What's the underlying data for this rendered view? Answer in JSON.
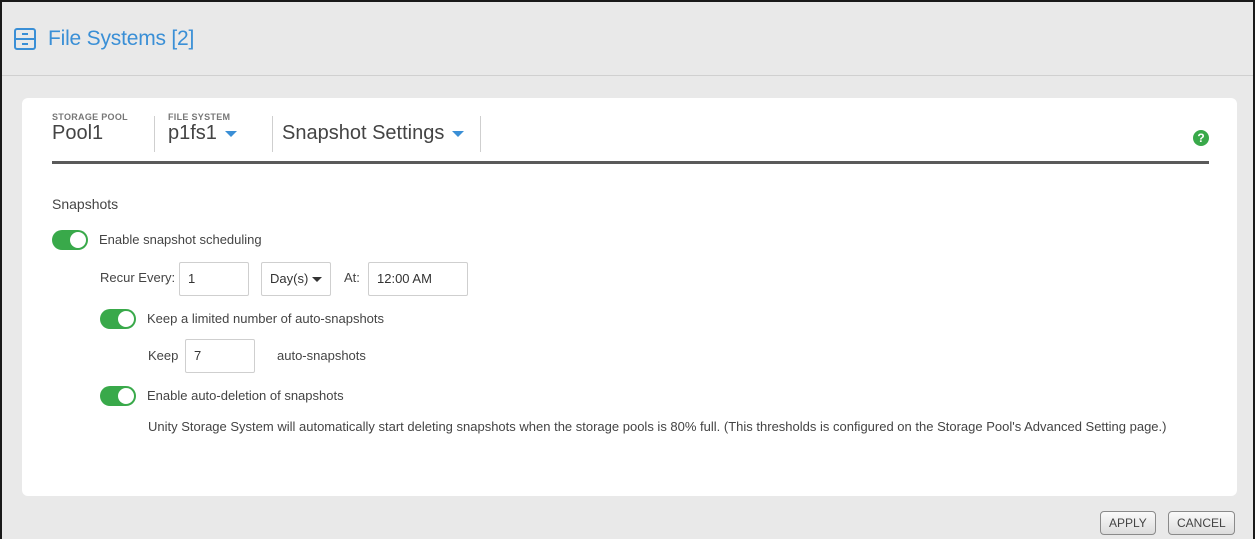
{
  "header": {
    "title": "File Systems [2]",
    "icon": "file-system-icon",
    "accent": "#3a8fd6"
  },
  "breadcrumb": {
    "storage_pool_label": "STORAGE POOL",
    "storage_pool_value": "Pool1",
    "file_system_label": "FILE SYSTEM",
    "file_system_value": "p1fs1",
    "settings_value": "Snapshot Settings",
    "help_icon": "?"
  },
  "snapshots": {
    "section_title": "Snapshots",
    "enable_scheduling": {
      "label": "Enable snapshot scheduling",
      "on": true
    },
    "recur_every_label": "Recur Every:",
    "recur_every_value": "1",
    "unit_value": "Day(s)",
    "at_label": "At:",
    "at_value": "12:00 AM",
    "keep_limited": {
      "label": "Keep a limited number of auto-snapshots",
      "on": true
    },
    "keep_label": "Keep",
    "keep_value": "7",
    "keep_suffix": "auto-snapshots",
    "auto_deletion": {
      "label": "Enable auto-deletion of snapshots",
      "on": true
    },
    "auto_deletion_note": "Unity Storage System will automatically start deleting snapshots when the storage pools is 80% full. (This thresholds is configured on the Storage Pool's Advanced Setting page.)",
    "toggle_color": "#39a94a"
  },
  "footer": {
    "apply_label": "APPLY",
    "cancel_label": "CANCEL"
  }
}
